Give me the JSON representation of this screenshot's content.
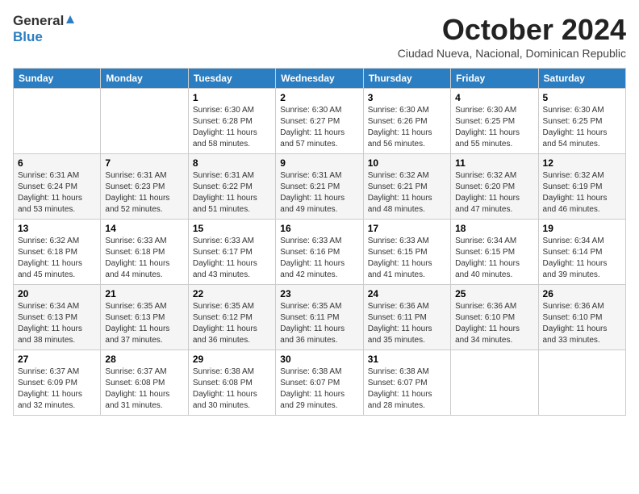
{
  "header": {
    "logo_general": "General",
    "logo_blue": "Blue",
    "month_title": "October 2024",
    "location": "Ciudad Nueva, Nacional, Dominican Republic"
  },
  "days_of_week": [
    "Sunday",
    "Monday",
    "Tuesday",
    "Wednesday",
    "Thursday",
    "Friday",
    "Saturday"
  ],
  "weeks": [
    [
      {
        "day": "",
        "sunrise": "",
        "sunset": "",
        "daylight": ""
      },
      {
        "day": "",
        "sunrise": "",
        "sunset": "",
        "daylight": ""
      },
      {
        "day": "1",
        "sunrise": "Sunrise: 6:30 AM",
        "sunset": "Sunset: 6:28 PM",
        "daylight": "Daylight: 11 hours and 58 minutes."
      },
      {
        "day": "2",
        "sunrise": "Sunrise: 6:30 AM",
        "sunset": "Sunset: 6:27 PM",
        "daylight": "Daylight: 11 hours and 57 minutes."
      },
      {
        "day": "3",
        "sunrise": "Sunrise: 6:30 AM",
        "sunset": "Sunset: 6:26 PM",
        "daylight": "Daylight: 11 hours and 56 minutes."
      },
      {
        "day": "4",
        "sunrise": "Sunrise: 6:30 AM",
        "sunset": "Sunset: 6:25 PM",
        "daylight": "Daylight: 11 hours and 55 minutes."
      },
      {
        "day": "5",
        "sunrise": "Sunrise: 6:30 AM",
        "sunset": "Sunset: 6:25 PM",
        "daylight": "Daylight: 11 hours and 54 minutes."
      }
    ],
    [
      {
        "day": "6",
        "sunrise": "Sunrise: 6:31 AM",
        "sunset": "Sunset: 6:24 PM",
        "daylight": "Daylight: 11 hours and 53 minutes."
      },
      {
        "day": "7",
        "sunrise": "Sunrise: 6:31 AM",
        "sunset": "Sunset: 6:23 PM",
        "daylight": "Daylight: 11 hours and 52 minutes."
      },
      {
        "day": "8",
        "sunrise": "Sunrise: 6:31 AM",
        "sunset": "Sunset: 6:22 PM",
        "daylight": "Daylight: 11 hours and 51 minutes."
      },
      {
        "day": "9",
        "sunrise": "Sunrise: 6:31 AM",
        "sunset": "Sunset: 6:21 PM",
        "daylight": "Daylight: 11 hours and 49 minutes."
      },
      {
        "day": "10",
        "sunrise": "Sunrise: 6:32 AM",
        "sunset": "Sunset: 6:21 PM",
        "daylight": "Daylight: 11 hours and 48 minutes."
      },
      {
        "day": "11",
        "sunrise": "Sunrise: 6:32 AM",
        "sunset": "Sunset: 6:20 PM",
        "daylight": "Daylight: 11 hours and 47 minutes."
      },
      {
        "day": "12",
        "sunrise": "Sunrise: 6:32 AM",
        "sunset": "Sunset: 6:19 PM",
        "daylight": "Daylight: 11 hours and 46 minutes."
      }
    ],
    [
      {
        "day": "13",
        "sunrise": "Sunrise: 6:32 AM",
        "sunset": "Sunset: 6:18 PM",
        "daylight": "Daylight: 11 hours and 45 minutes."
      },
      {
        "day": "14",
        "sunrise": "Sunrise: 6:33 AM",
        "sunset": "Sunset: 6:18 PM",
        "daylight": "Daylight: 11 hours and 44 minutes."
      },
      {
        "day": "15",
        "sunrise": "Sunrise: 6:33 AM",
        "sunset": "Sunset: 6:17 PM",
        "daylight": "Daylight: 11 hours and 43 minutes."
      },
      {
        "day": "16",
        "sunrise": "Sunrise: 6:33 AM",
        "sunset": "Sunset: 6:16 PM",
        "daylight": "Daylight: 11 hours and 42 minutes."
      },
      {
        "day": "17",
        "sunrise": "Sunrise: 6:33 AM",
        "sunset": "Sunset: 6:15 PM",
        "daylight": "Daylight: 11 hours and 41 minutes."
      },
      {
        "day": "18",
        "sunrise": "Sunrise: 6:34 AM",
        "sunset": "Sunset: 6:15 PM",
        "daylight": "Daylight: 11 hours and 40 minutes."
      },
      {
        "day": "19",
        "sunrise": "Sunrise: 6:34 AM",
        "sunset": "Sunset: 6:14 PM",
        "daylight": "Daylight: 11 hours and 39 minutes."
      }
    ],
    [
      {
        "day": "20",
        "sunrise": "Sunrise: 6:34 AM",
        "sunset": "Sunset: 6:13 PM",
        "daylight": "Daylight: 11 hours and 38 minutes."
      },
      {
        "day": "21",
        "sunrise": "Sunrise: 6:35 AM",
        "sunset": "Sunset: 6:13 PM",
        "daylight": "Daylight: 11 hours and 37 minutes."
      },
      {
        "day": "22",
        "sunrise": "Sunrise: 6:35 AM",
        "sunset": "Sunset: 6:12 PM",
        "daylight": "Daylight: 11 hours and 36 minutes."
      },
      {
        "day": "23",
        "sunrise": "Sunrise: 6:35 AM",
        "sunset": "Sunset: 6:11 PM",
        "daylight": "Daylight: 11 hours and 36 minutes."
      },
      {
        "day": "24",
        "sunrise": "Sunrise: 6:36 AM",
        "sunset": "Sunset: 6:11 PM",
        "daylight": "Daylight: 11 hours and 35 minutes."
      },
      {
        "day": "25",
        "sunrise": "Sunrise: 6:36 AM",
        "sunset": "Sunset: 6:10 PM",
        "daylight": "Daylight: 11 hours and 34 minutes."
      },
      {
        "day": "26",
        "sunrise": "Sunrise: 6:36 AM",
        "sunset": "Sunset: 6:10 PM",
        "daylight": "Daylight: 11 hours and 33 minutes."
      }
    ],
    [
      {
        "day": "27",
        "sunrise": "Sunrise: 6:37 AM",
        "sunset": "Sunset: 6:09 PM",
        "daylight": "Daylight: 11 hours and 32 minutes."
      },
      {
        "day": "28",
        "sunrise": "Sunrise: 6:37 AM",
        "sunset": "Sunset: 6:08 PM",
        "daylight": "Daylight: 11 hours and 31 minutes."
      },
      {
        "day": "29",
        "sunrise": "Sunrise: 6:38 AM",
        "sunset": "Sunset: 6:08 PM",
        "daylight": "Daylight: 11 hours and 30 minutes."
      },
      {
        "day": "30",
        "sunrise": "Sunrise: 6:38 AM",
        "sunset": "Sunset: 6:07 PM",
        "daylight": "Daylight: 11 hours and 29 minutes."
      },
      {
        "day": "31",
        "sunrise": "Sunrise: 6:38 AM",
        "sunset": "Sunset: 6:07 PM",
        "daylight": "Daylight: 11 hours and 28 minutes."
      },
      {
        "day": "",
        "sunrise": "",
        "sunset": "",
        "daylight": ""
      },
      {
        "day": "",
        "sunrise": "",
        "sunset": "",
        "daylight": ""
      }
    ]
  ]
}
